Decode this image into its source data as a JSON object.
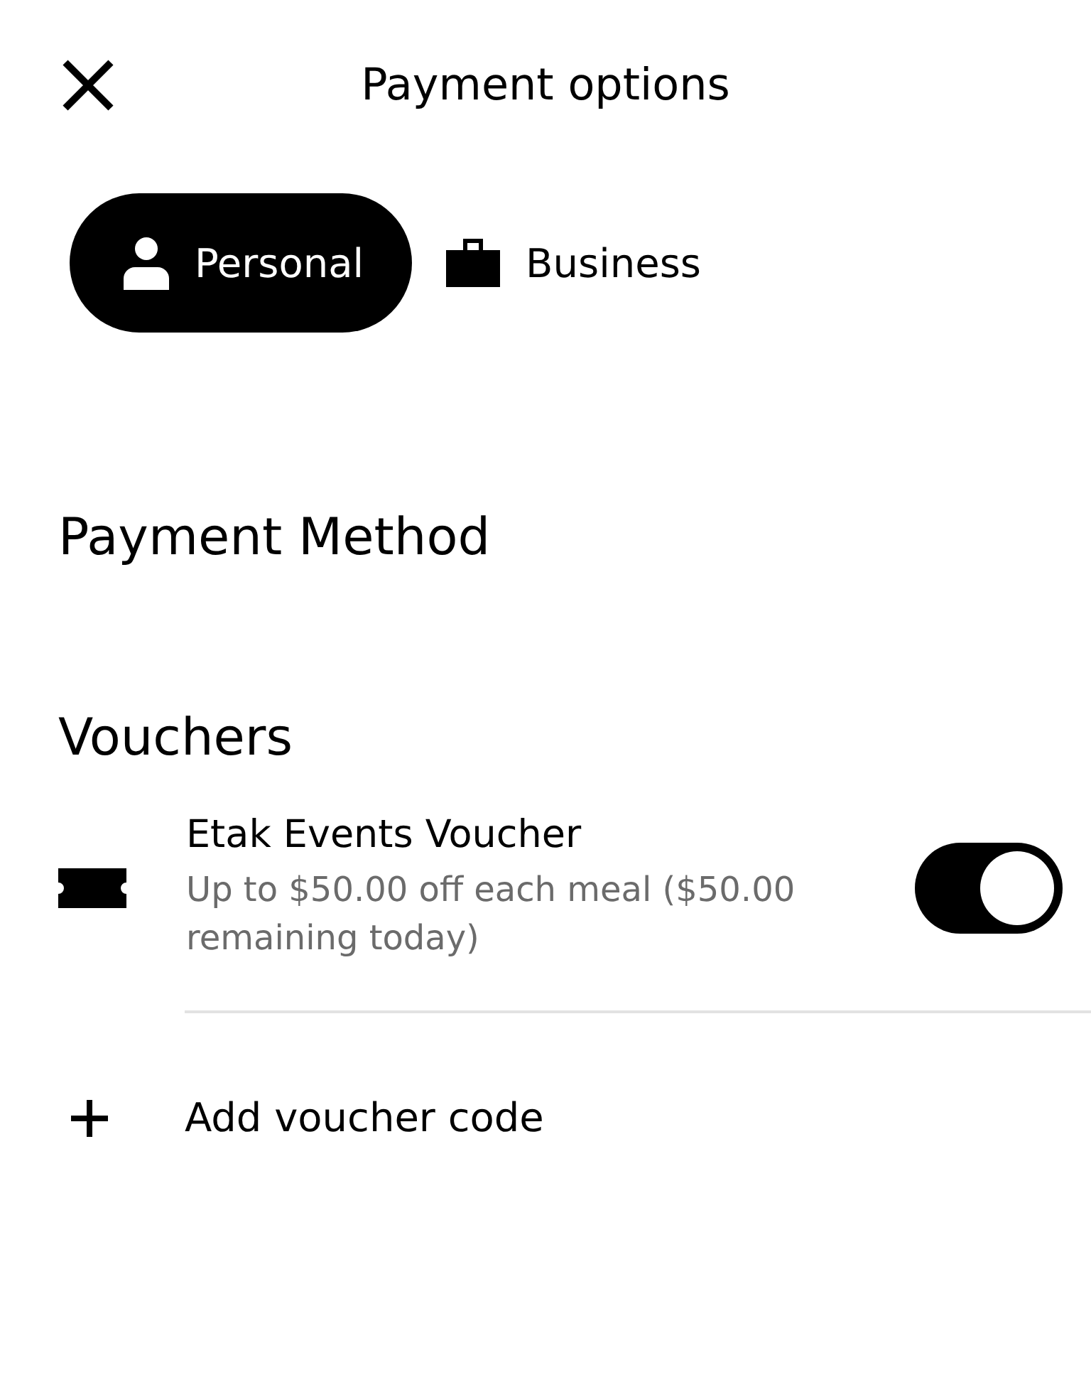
{
  "header": {
    "title": "Payment options"
  },
  "tabs": [
    {
      "label": "Personal",
      "kind": "person",
      "selected": true
    },
    {
      "label": "Business",
      "kind": "briefcase",
      "selected": false
    }
  ],
  "sections": [
    {
      "title": "Payment Method"
    },
    {
      "title": "Vouchers"
    }
  ],
  "vouchers": [
    {
      "title": "Etak Events Voucher",
      "description": "Up to $50.00 off each meal ($50.00 remaining today)",
      "on": true
    }
  ],
  "add_voucher": {
    "label": "Add voucher code"
  }
}
